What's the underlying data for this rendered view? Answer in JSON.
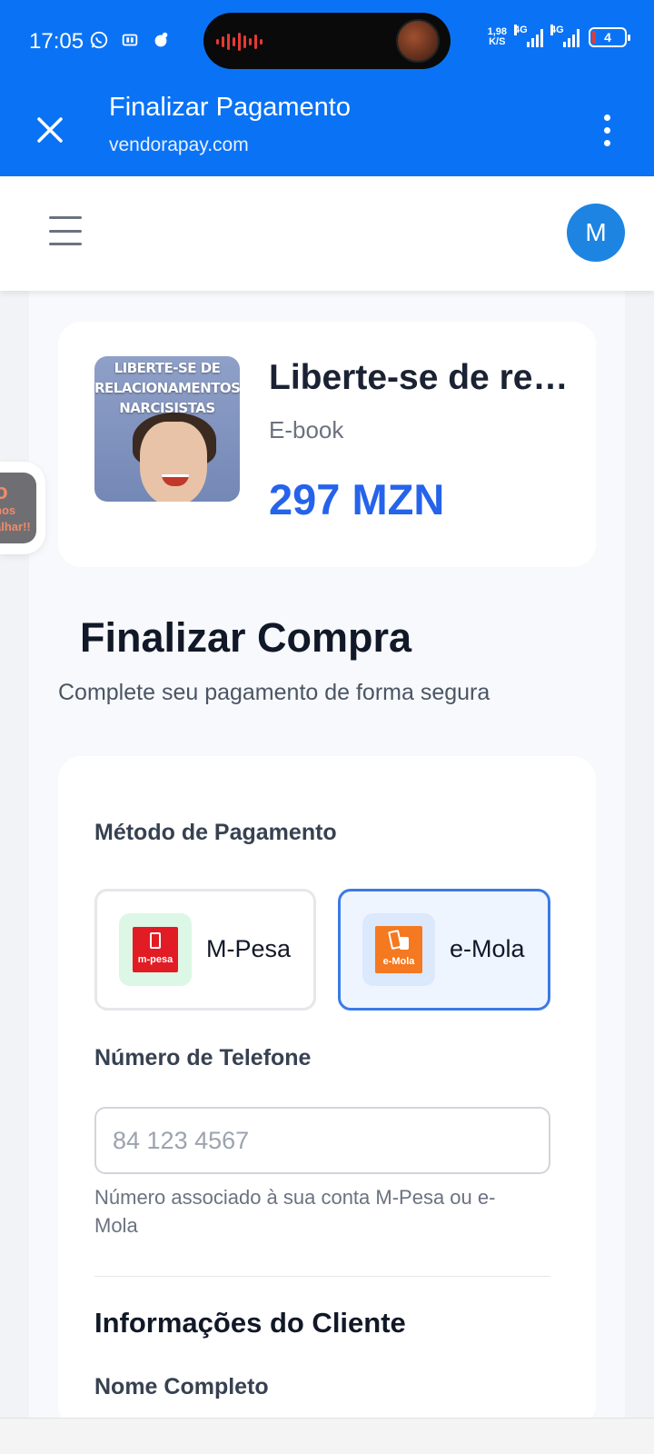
{
  "status_bar": {
    "time": "17:05",
    "net_speed_value": "1,98",
    "net_speed_unit": "K/S",
    "signal_1_label": "4G",
    "signal_2_label": "4G",
    "battery_level": "4",
    "accent_color": "#0a73f5"
  },
  "browser": {
    "title": "Finalizar Pagamento",
    "url": "vendorapay.com"
  },
  "header": {
    "avatar_initial": "M"
  },
  "floating_widget": {
    "line1": "o",
    "line2": "nos",
    "line3": "alhar!!"
  },
  "product": {
    "cover_text_lines": [
      "LIBERTE-SE DE",
      "RELACIONAMENTOS",
      "NARCISISTAS"
    ],
    "title": "Liberte-se de relacionamentos narcisistas",
    "type": "E-book",
    "price": "297 MZN",
    "price_color": "#2563eb"
  },
  "checkout": {
    "title": "Finalizar Compra",
    "subtitle": "Complete seu pagamento de forma segura",
    "payment_method_label": "Método de Pagamento",
    "payment_options": [
      {
        "label": "M-Pesa",
        "logo_text": "m-pesa",
        "selected": false,
        "brand_color": "#e11c24"
      },
      {
        "label": "e-Mola",
        "logo_text": "e-Mola",
        "selected": true,
        "brand_color": "#f47920"
      }
    ],
    "phone_label": "Número de Telefone",
    "phone_value": "",
    "phone_placeholder": "84 123 4567",
    "phone_help": "Número associado à sua conta M-Pesa ou e-Mola",
    "client_section_title": "Informações do Cliente",
    "full_name_label": "Nome Completo"
  }
}
